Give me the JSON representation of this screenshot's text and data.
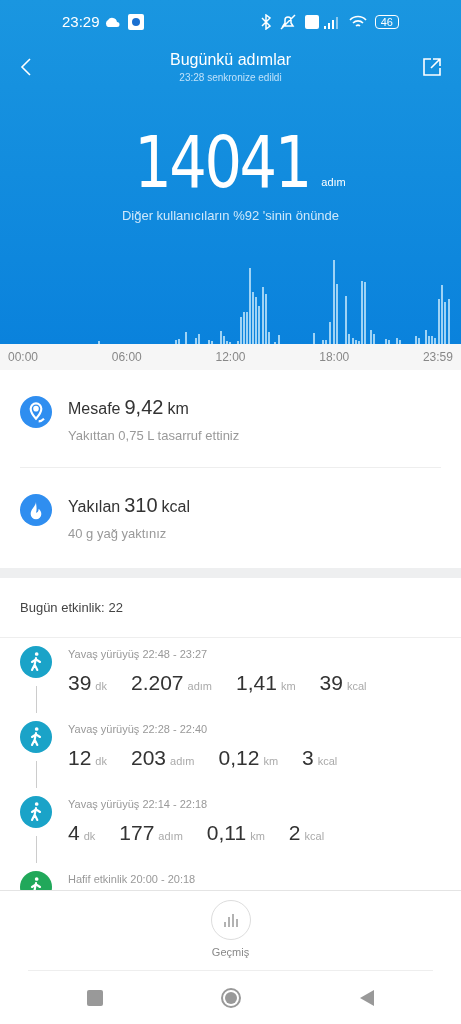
{
  "status_bar": {
    "time": "23:29",
    "battery": "46"
  },
  "header": {
    "title": "Bugünkü adımlar",
    "subtitle": "23:28 senkronize edildi"
  },
  "steps": {
    "value": "14041",
    "unit": "adım",
    "comparison": "Diğer kullanıcıların %92 'sinin önünde"
  },
  "chart_axis": [
    "00:00",
    "06:00",
    "12:00",
    "18:00",
    "23:59"
  ],
  "summary": [
    {
      "kind": "distance",
      "label": "Mesafe",
      "value": "9,42",
      "unit": "km",
      "note": "Yakıttan 0,75 L tasarruf ettiniz"
    },
    {
      "kind": "calories",
      "label": "Yakılan",
      "value": "310",
      "unit": "kcal",
      "note": "40 g yağ yaktınız"
    }
  ],
  "activity_header": {
    "label": "Bugün etkinlik:",
    "count": "22"
  },
  "activities": [
    {
      "kind": "walk",
      "title": "Yavaş yürüyüş 22:48 - 23:27",
      "stats": [
        {
          "value": "39",
          "unit": "dk"
        },
        {
          "value": "2.207",
          "unit": "adım"
        },
        {
          "value": "1,41",
          "unit": "km"
        },
        {
          "value": "39",
          "unit": "kcal"
        }
      ]
    },
    {
      "kind": "walk",
      "title": "Yavaş yürüyüş 22:28 - 22:40",
      "stats": [
        {
          "value": "12",
          "unit": "dk"
        },
        {
          "value": "203",
          "unit": "adım"
        },
        {
          "value": "0,12",
          "unit": "km"
        },
        {
          "value": "3",
          "unit": "kcal"
        }
      ]
    },
    {
      "kind": "walk",
      "title": "Yavaş yürüyüş 22:14 - 22:18",
      "stats": [
        {
          "value": "4",
          "unit": "dk"
        },
        {
          "value": "177",
          "unit": "adım"
        },
        {
          "value": "0,11",
          "unit": "km"
        },
        {
          "value": "2",
          "unit": "kcal"
        }
      ]
    },
    {
      "kind": "light",
      "title": "Hafif etkinlik 20:00 - 20:18"
    }
  ],
  "history_button": {
    "label": "Geçmiş"
  }
}
